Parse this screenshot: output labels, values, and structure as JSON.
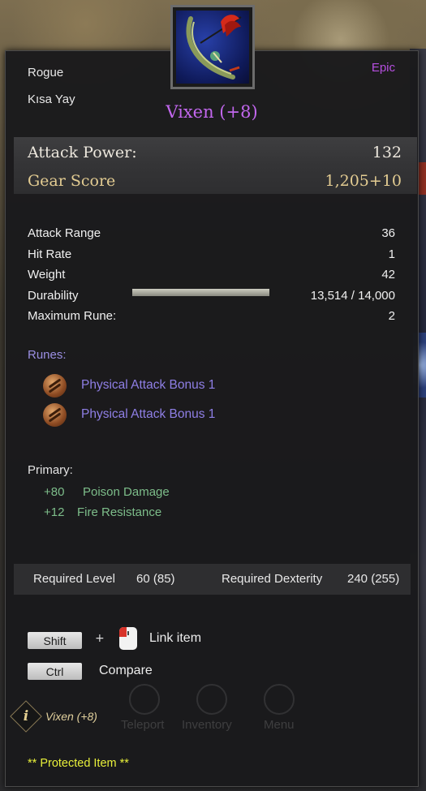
{
  "item": {
    "class": "Rogue",
    "weapon_type": "Kısa Yay",
    "rarity": "Epic",
    "name": "Vixen (+8)",
    "icon": "bow-item-icon"
  },
  "main_stats": {
    "attack_power_label": "Attack Power:",
    "attack_power_value": "132",
    "gear_score_label": "Gear Score",
    "gear_score_value": "1,205+10"
  },
  "stats": [
    {
      "label": "Attack Range",
      "value": "36"
    },
    {
      "label": "Hit Rate",
      "value": "1"
    },
    {
      "label": "Weight",
      "value": "42"
    },
    {
      "label": "Durability",
      "value": "13,514 / 14,000"
    },
    {
      "label": "Maximum Rune:",
      "value": "2"
    }
  ],
  "durability_fraction": 0.9653,
  "runes": {
    "title": "Runes:",
    "items": [
      {
        "label": "Physical Attack Bonus 1",
        "icon": "rune-icon"
      },
      {
        "label": "Physical Attack Bonus 1",
        "icon": "rune-icon"
      }
    ]
  },
  "primary": {
    "title": "Primary:",
    "items": [
      {
        "value": "+80",
        "label": "Poison Damage"
      },
      {
        "value": "+12",
        "label": "Fire Resistance"
      }
    ]
  },
  "requirements": {
    "level_label": "Required Level",
    "level_value": "60 (85)",
    "dex_label": "Required Dexterity",
    "dex_value": "240 (255)"
  },
  "hints": {
    "shift_key": "Shift",
    "plus": "+",
    "link_label": "Link item",
    "ctrl_key": "Ctrl",
    "compare_label": "Compare"
  },
  "footer": {
    "info_glyph": "i",
    "item_name": "Vixen (+8)",
    "protected": "** Protected Item **"
  },
  "background_menu": {
    "items": [
      "Teleport",
      "Inventory",
      "Menu"
    ]
  },
  "colors": {
    "epic": "#b64fe0",
    "gear_score": "#e3cc92",
    "rune_text": "#8f7fe6",
    "primary_text": "#7dbd8a",
    "protected": "#e8f03a"
  }
}
